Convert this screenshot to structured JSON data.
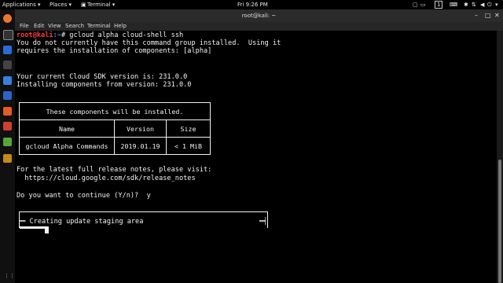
{
  "topbar": {
    "applications": "Applications ▾",
    "places": "Places ▾",
    "terminal": "Terminal ▾",
    "clock": "Fri  9:26 PM",
    "workspace": "1"
  },
  "window": {
    "title": "root@kali: ~",
    "menu": [
      "File",
      "Edit",
      "View",
      "Search",
      "Terminal",
      "Help"
    ]
  },
  "terminal": {
    "prompt_user": "root@kali",
    "prompt_path": ":~",
    "prompt_symbol": "# ",
    "command": "gcloud alpha cloud-shell ssh",
    "lines": [
      "You do not currently have this command group installed.  Using it",
      "requires the installation of components: [alpha]",
      "",
      "Your current Cloud SDK version is: 231.0.0",
      "Installing components from version: 231.0.0"
    ],
    "table": {
      "caption": "These components will be installed.",
      "headers": [
        "Name",
        "Version",
        "Size"
      ],
      "rows": [
        [
          "gcloud Alpha Commands",
          "2019.01.19",
          "< 1 MiB"
        ]
      ]
    },
    "release_notes": "For the latest full release notes, please visit:",
    "release_url": "  https://cloud.google.com/sdk/release_notes",
    "continue_prompt": "Do you want to continue (Y/n)?  y",
    "progress_label": "╞═ Creating update staging area",
    "progress_end": "═╡",
    "progress_fraction": 0.1
  }
}
